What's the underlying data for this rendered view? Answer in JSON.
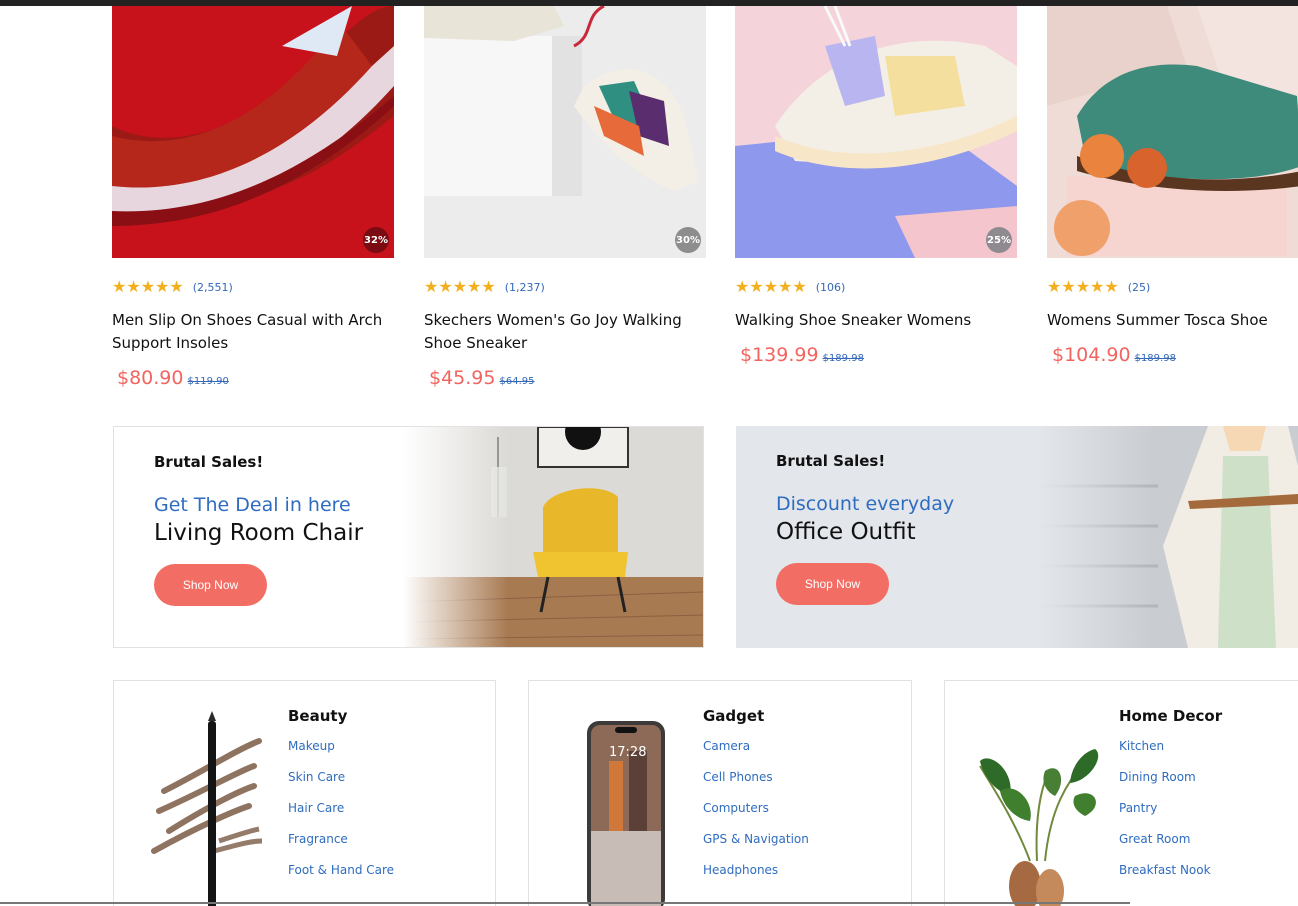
{
  "products": [
    {
      "title": "Men Slip On Shoes Casual with Arch Support Insoles",
      "reviews": "(2,551)",
      "price": "$80.90",
      "old_price": "$119.90",
      "discount": "32%",
      "rating": 5,
      "badge_color": "#7a0b12"
    },
    {
      "title": "Skechers Women's Go Joy Walking Shoe Sneaker",
      "reviews": "(1,237)",
      "price": "$45.95",
      "old_price": "$64.95",
      "discount": "30%",
      "rating": 5,
      "badge_color": "#8d8d8d"
    },
    {
      "title": "Walking Shoe Sneaker Womens",
      "reviews": "(106)",
      "price": "$139.99",
      "old_price": "$189.98",
      "discount": "25%",
      "rating": 5,
      "badge_color": "#8f8a90"
    },
    {
      "title": "Womens Summer Tosca Shoe",
      "reviews": "(25)",
      "price": "$104.90",
      "old_price": "$189.98",
      "discount": "",
      "rating": 5,
      "badge_color": ""
    }
  ],
  "banners": [
    {
      "kicker": "Brutal Sales!",
      "subtitle": "Get The Deal in here",
      "headline": "Living Room Chair",
      "button": "Shop Now"
    },
    {
      "kicker": "Brutal Sales!",
      "subtitle": "Discount everyday",
      "headline": "Office Outfit",
      "button": "Shop Now"
    }
  ],
  "categories": [
    {
      "title": "Beauty",
      "links": [
        "Makeup",
        "Skin Care",
        "Hair Care",
        "Fragrance",
        "Foot & Hand Care"
      ]
    },
    {
      "title": "Gadget",
      "links": [
        "Camera",
        "Cell Phones",
        "Computers",
        "GPS & Navigation",
        "Headphones"
      ]
    },
    {
      "title": "Home Decor",
      "links": [
        "Kitchen",
        "Dining Room",
        "Pantry",
        "Great Room",
        "Breakfast Nook"
      ]
    }
  ],
  "phone_time": "17:28",
  "colors": {
    "accent": "#f26e64",
    "price": "#f2645f",
    "link": "#2f6cc0",
    "star": "#f2b01e"
  }
}
